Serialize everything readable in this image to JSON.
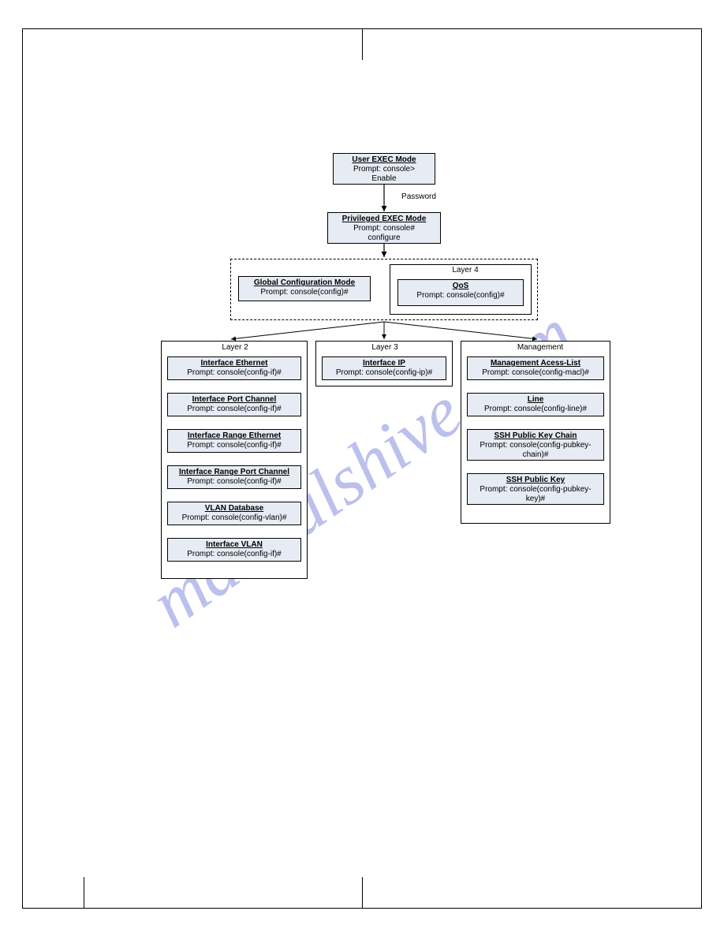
{
  "watermark": "manualshive.com",
  "edge_labels": {
    "password": "Password"
  },
  "nodes": {
    "user_exec": {
      "title": "User EXEC Mode",
      "line1": "Prompt: console>",
      "line2": "Enable"
    },
    "priv_exec": {
      "title": "Privileged EXEC Mode",
      "line1": "Prompt: console#",
      "line2": "configure"
    },
    "global_config": {
      "title": "Global Configuration Mode",
      "line1": "Prompt: console(config)#"
    },
    "qos": {
      "title": "QoS",
      "line1": "Prompt: console(config)#"
    },
    "if_ethernet": {
      "title": "Interface Ethernet",
      "line1": "Prompt: console(config-if)#"
    },
    "if_port_channel": {
      "title": "Interface Port Channel",
      "line1": "Prompt: console(config-if)#"
    },
    "if_range_ethernet": {
      "title": "Interface Range Ethernet",
      "line1": "Prompt: console(config-if)#"
    },
    "if_range_port_channel": {
      "title": "Interface Range Port Channel",
      "line1": "Prompt: console(config-if)#"
    },
    "vlan_database": {
      "title": "VLAN Database",
      "line1": "Prompt: console(config-vlan)#"
    },
    "if_vlan": {
      "title": "Interface VLAN",
      "line1": "Prompt: console(config-if)#"
    },
    "if_ip": {
      "title": "Interface IP",
      "line1": "Prompt: console(config-ip)#"
    },
    "mgmt_acl": {
      "title": "Management Acess-List",
      "line1": "Prompt: console(config-macl)#"
    },
    "line": {
      "title": "Line",
      "line1": "Prompt: console(config-line)#"
    },
    "ssh_chain": {
      "title": "SSH Public Key Chain",
      "line1": "Prompt: console(config-pubkey-chain)#"
    },
    "ssh_key": {
      "title": "SSH Public Key",
      "line1": "Prompt: console(config-pubkey-key)#"
    }
  },
  "groups": {
    "layer4": "Layer 4",
    "layer2": "Layer 2",
    "layer3": "Layer 3",
    "management": "Management"
  }
}
